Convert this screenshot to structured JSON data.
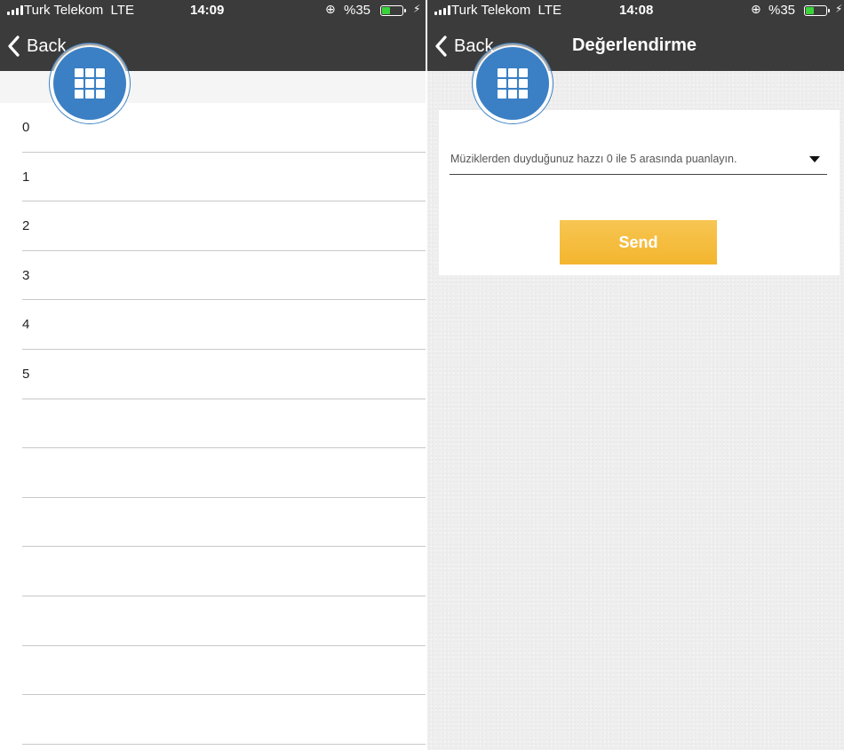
{
  "left_screen": {
    "status": {
      "carrier": "Turk Telekom",
      "network": "LTE",
      "time": "14:09",
      "battery": "%35"
    },
    "nav": {
      "back_label": "Back",
      "title": ""
    },
    "rating_options": [
      "0",
      "1",
      "2",
      "3",
      "4",
      "5",
      "",
      "",
      "",
      "",
      "",
      "",
      ""
    ]
  },
  "right_screen": {
    "status": {
      "carrier": "Turk Telekom",
      "network": "LTE",
      "time": "14:08",
      "battery": "%35"
    },
    "nav": {
      "back_label": "Back",
      "title": "Değerlendirme"
    },
    "form": {
      "question_select_value": "Müziklerden duyduğunuz hazzı 0 ile 5 arasında puanlayın.",
      "send_label": "Send"
    }
  },
  "colors": {
    "navbar": "#3b3b3b",
    "fab": "#3b80c5",
    "send_button": "#f5bd3f",
    "battery_fill": "#3ad33a",
    "separator": "#c8c8c8"
  },
  "icons": {
    "back": "chevron-left-icon",
    "menu": "grid-menu-icon",
    "dropdown": "caret-down-icon",
    "orientation_lock": "orientation-lock-icon",
    "charging": "lightning-icon"
  }
}
